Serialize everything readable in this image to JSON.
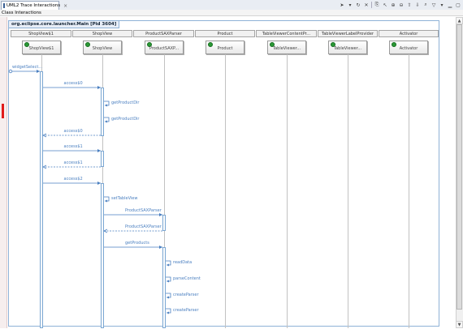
{
  "window": {
    "tab_title": "UML2 Trace Interactions",
    "tab_close": "×",
    "subtitle": "Class Interactions"
  },
  "toolbar": [
    {
      "icon": "run-icon",
      "glyph": "➤"
    },
    {
      "icon": "dropdown-icon",
      "glyph": "▾"
    },
    {
      "icon": "refresh-icon",
      "glyph": "↻"
    },
    {
      "icon": "cancel-icon",
      "glyph": "✕"
    },
    {
      "icon": "sep"
    },
    {
      "icon": "copy-icon",
      "glyph": "⎘"
    },
    {
      "icon": "cursor-icon",
      "glyph": "↖"
    },
    {
      "icon": "zoom-in-icon",
      "glyph": "⊕"
    },
    {
      "icon": "zoom-out-icon",
      "glyph": "⊖"
    },
    {
      "icon": "arrow-up-icon",
      "glyph": "⇧"
    },
    {
      "icon": "arrow-down-icon",
      "glyph": "⇩"
    },
    {
      "icon": "find-icon",
      "glyph": "⌕"
    },
    {
      "icon": "filter-icon",
      "glyph": "▽"
    },
    {
      "icon": "menu-icon",
      "glyph": "▾"
    },
    {
      "icon": "minimize-icon",
      "glyph": "▁"
    },
    {
      "icon": "maximize-icon",
      "glyph": "▢"
    }
  ],
  "diagram": {
    "frame_title": "org.eclipse.core.launcher.Main [Pid 3604]",
    "lifelines": [
      {
        "header": "ShopView$1",
        "box": "ShopView$1"
      },
      {
        "header": "ShopView",
        "box": "ShopView"
      },
      {
        "header": "ProductSAXParser",
        "box": "ProductSAXP..."
      },
      {
        "header": "Product",
        "box": "Product"
      },
      {
        "header": "TableViewerContentPr...",
        "box": "TableViewer..."
      },
      {
        "header": "TableViewerLabelProvider",
        "box": "TableViewer..."
      },
      {
        "header": "Activator",
        "box": "Activator"
      }
    ],
    "messages": [
      {
        "label": "widgetSelect...",
        "from": -1,
        "to": 0,
        "kind": "call"
      },
      {
        "label": "access$0",
        "from": 0,
        "to": 1,
        "kind": "call"
      },
      {
        "label": "getProductDir",
        "from": 1,
        "to": 1,
        "kind": "self"
      },
      {
        "label": "getProductDir",
        "from": 1,
        "to": 1,
        "kind": "self"
      },
      {
        "label": "access$0",
        "from": 1,
        "to": 0,
        "kind": "return"
      },
      {
        "label": "access$1",
        "from": 0,
        "to": 1,
        "kind": "call"
      },
      {
        "label": "access$1",
        "from": 1,
        "to": 0,
        "kind": "return"
      },
      {
        "label": "access$2",
        "from": 0,
        "to": 1,
        "kind": "call"
      },
      {
        "label": "setTableView",
        "from": 1,
        "to": 1,
        "kind": "self"
      },
      {
        "label": "ProductSAXParser",
        "from": 1,
        "to": 2,
        "kind": "call"
      },
      {
        "label": "ProductSAXParser",
        "from": 2,
        "to": 1,
        "kind": "return"
      },
      {
        "label": "getProducts",
        "from": 1,
        "to": 2,
        "kind": "call"
      },
      {
        "label": "readData",
        "from": 2,
        "to": 2,
        "kind": "self"
      },
      {
        "label": "parseContent",
        "from": 2,
        "to": 2,
        "kind": "self"
      },
      {
        "label": "createParser",
        "from": 2,
        "to": 2,
        "kind": "self"
      },
      {
        "label": "createParser",
        "from": 2,
        "to": 2,
        "kind": "self"
      }
    ]
  },
  "colors": {
    "message": "#4a7fc0",
    "activation_border": "#7aa6d2",
    "marker": "#e01b1b"
  }
}
